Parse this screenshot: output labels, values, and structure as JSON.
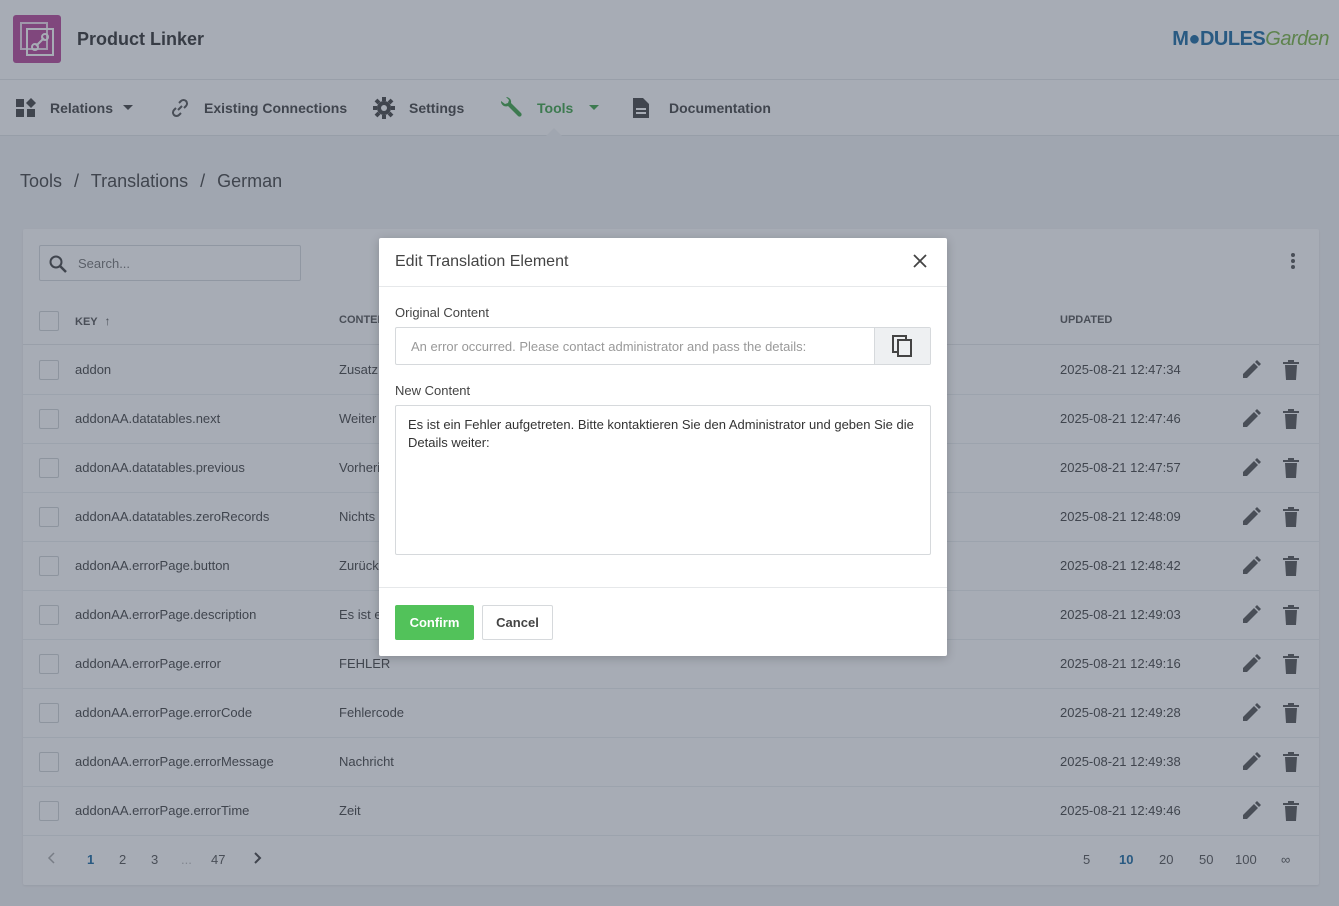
{
  "app": {
    "title": "Product Linker",
    "brand_part1": "M",
    "brand_part2": "DULES",
    "brand_part3": "Garden",
    "accent": "#b8479a"
  },
  "nav": {
    "items": [
      {
        "label": "Relations",
        "icon": "dashboard-icon",
        "dropdown": true
      },
      {
        "label": "Existing Connections",
        "icon": "link-icon"
      },
      {
        "label": "Settings",
        "icon": "gear-icon"
      },
      {
        "label": "Tools",
        "icon": "wrench-icon",
        "dropdown": true,
        "active": true
      },
      {
        "label": "Documentation",
        "icon": "document-icon"
      }
    ]
  },
  "breadcrumb": [
    "Tools",
    "/",
    "Translations",
    "/",
    "German"
  ],
  "search": {
    "placeholder": "Search..."
  },
  "table": {
    "headers": {
      "key": "KEY",
      "content": "CONTENT",
      "updated": "UPDATED"
    },
    "rows": [
      {
        "key": "addon",
        "content": "Zusatz",
        "updated": "2025-08-21 12:47:34"
      },
      {
        "key": "addonAA.datatables.next",
        "content": "Weiter",
        "updated": "2025-08-21 12:47:46"
      },
      {
        "key": "addonAA.datatables.previous",
        "content": "Vorheri",
        "updated": "2025-08-21 12:47:57"
      },
      {
        "key": "addonAA.datatables.zeroRecords",
        "content": "Nichts",
        "updated": "2025-08-21 12:48:09"
      },
      {
        "key": "addonAA.errorPage.button",
        "content": "Zurück",
        "updated": "2025-08-21 12:48:42"
      },
      {
        "key": "addonAA.errorPage.description",
        "content": "Es ist e",
        "updated": "2025-08-21 12:49:03"
      },
      {
        "key": "addonAA.errorPage.error",
        "content": "FEHLER",
        "updated": "2025-08-21 12:49:16"
      },
      {
        "key": "addonAA.errorPage.errorCode",
        "content": "Fehlercode",
        "updated": "2025-08-21 12:49:28"
      },
      {
        "key": "addonAA.errorPage.errorMessage",
        "content": "Nachricht",
        "updated": "2025-08-21 12:49:38"
      },
      {
        "key": "addonAA.errorPage.errorTime",
        "content": "Zeit",
        "updated": "2025-08-21 12:49:46"
      }
    ]
  },
  "pagination": {
    "pages": [
      "1",
      "2",
      "3",
      "...",
      "47"
    ],
    "current": "1",
    "per_page": [
      "5",
      "10",
      "20",
      "50",
      "100",
      "∞"
    ],
    "per_page_current": "10"
  },
  "modal": {
    "title": "Edit Translation Element",
    "original_label": "Original Content",
    "original_value": "An error occurred. Please contact administrator and pass the details:",
    "new_label": "New Content",
    "new_value": "Es ist ein Fehler aufgetreten. Bitte kontaktieren Sie den Administrator und geben Sie die Details weiter:",
    "confirm_label": "Confirm",
    "cancel_label": "Cancel",
    "confirm_color": "#52c25a"
  }
}
